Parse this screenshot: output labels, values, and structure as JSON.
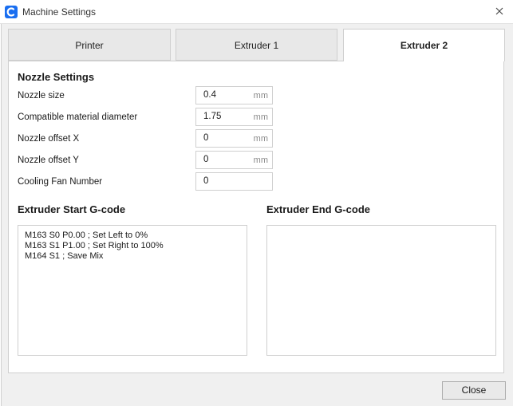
{
  "window": {
    "title": "Machine Settings",
    "close_icon": "close-icon"
  },
  "tabs": [
    {
      "label": "Printer",
      "active": false
    },
    {
      "label": "Extruder 1",
      "active": false
    },
    {
      "label": "Extruder 2",
      "active": true
    }
  ],
  "nozzle_settings": {
    "title": "Nozzle Settings",
    "rows": [
      {
        "label": "Nozzle size",
        "value": "0.4",
        "unit": "mm"
      },
      {
        "label": "Compatible material diameter",
        "value": "1.75",
        "unit": "mm"
      },
      {
        "label": "Nozzle offset X",
        "value": "0",
        "unit": "mm"
      },
      {
        "label": "Nozzle offset Y",
        "value": "0",
        "unit": "mm"
      },
      {
        "label": "Cooling Fan Number",
        "value": "0",
        "unit": ""
      }
    ]
  },
  "start_gcode": {
    "title": "Extruder Start G-code",
    "lines": [
      "M163 S0 P0.00 ; Set Left to 0%",
      "M163 S1 P1.00 ; Set Right to 100%",
      "M164 S1 ; Save Mix"
    ]
  },
  "end_gcode": {
    "title": "Extruder End G-code",
    "lines": []
  },
  "footer": {
    "close_label": "Close"
  },
  "colors": {
    "accent": "#196ef0",
    "panel_bg": "#ffffff",
    "window_bg": "#f0f0f0",
    "border": "#cfcfcf",
    "unit_text": "#8a8a8a"
  }
}
